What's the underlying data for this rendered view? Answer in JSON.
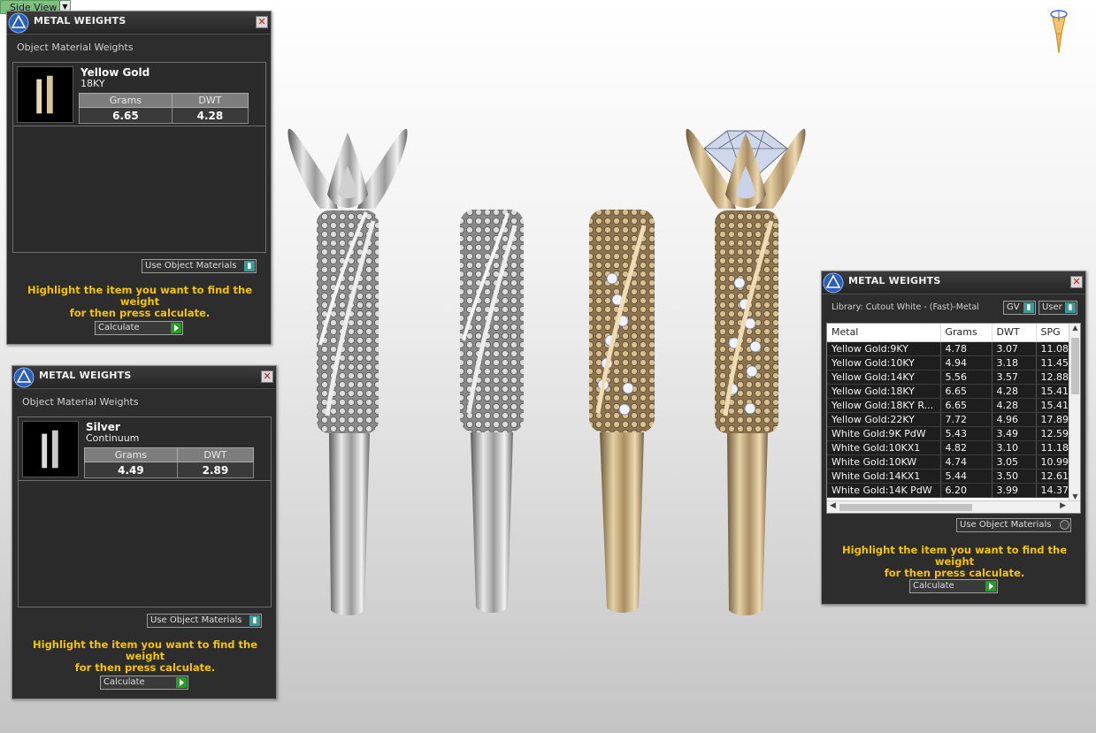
{
  "viewport": {
    "view_label": "Side View"
  },
  "panels": {
    "left_top": {
      "title": "METAL WEIGHTS",
      "subtitle": "Object Material Weights",
      "material_name": "Yellow Gold",
      "material_sub": "18KY",
      "col_grams": "Grams",
      "col_dwt": "DWT",
      "grams": "6.65",
      "dwt": "4.28",
      "dropdown": "Use Object Materials",
      "hint_line1": "Highlight the item you want to find the weight",
      "hint_line2": "for then press calculate.",
      "calc": "Calculate"
    },
    "left_bottom": {
      "title": "METAL WEIGHTS",
      "subtitle": "Object Material Weights",
      "material_name": "Silver",
      "material_sub": "Continuum",
      "col_grams": "Grams",
      "col_dwt": "DWT",
      "grams": "4.49",
      "dwt": "2.89",
      "dropdown": "Use Object Materials",
      "hint_line1": "Highlight the item you want to find the weight",
      "hint_line2": "for then press calculate.",
      "calc": "Calculate"
    },
    "right": {
      "title": "METAL WEIGHTS",
      "library": "Library: Cutout White - (Fast)-Metal",
      "gv": "GV",
      "user": "User",
      "headers": [
        "Metal",
        "Grams",
        "DWT",
        "SPG"
      ],
      "rows": [
        [
          "Yellow Gold:9KY",
          "4.78",
          "3.07",
          "11.08"
        ],
        [
          "Yellow Gold:10KY",
          "4.94",
          "3.18",
          "11.45"
        ],
        [
          "Yellow Gold:14KY",
          "5.56",
          "3.57",
          "12.88"
        ],
        [
          "Yellow Gold:18KY",
          "6.65",
          "4.28",
          "15.41"
        ],
        [
          "Yellow Gold:18KY R...",
          "6.65",
          "4.28",
          "15.41"
        ],
        [
          "Yellow Gold:22KY",
          "7.72",
          "4.96",
          "17.89"
        ],
        [
          "White Gold:9K PdW",
          "5.43",
          "3.49",
          "12.59"
        ],
        [
          "White Gold:10KX1",
          "4.82",
          "3.10",
          "11.18"
        ],
        [
          "White Gold:10KW",
          "4.74",
          "3.05",
          "10.99"
        ],
        [
          "White Gold:14KX1",
          "5.44",
          "3.50",
          "12.61"
        ],
        [
          "White Gold:14K PdW",
          "6.20",
          "3.99",
          "14.37"
        ]
      ],
      "dropdown": "Use Object Materials",
      "hint_line1": "Highlight the item you want to find the weight",
      "hint_line2": "for then press calculate.",
      "calc": "Calculate"
    }
  },
  "colors": {
    "hint": "#f5c400",
    "accent_toggle": "#3a9a9a",
    "go": "#2a9a2a"
  }
}
